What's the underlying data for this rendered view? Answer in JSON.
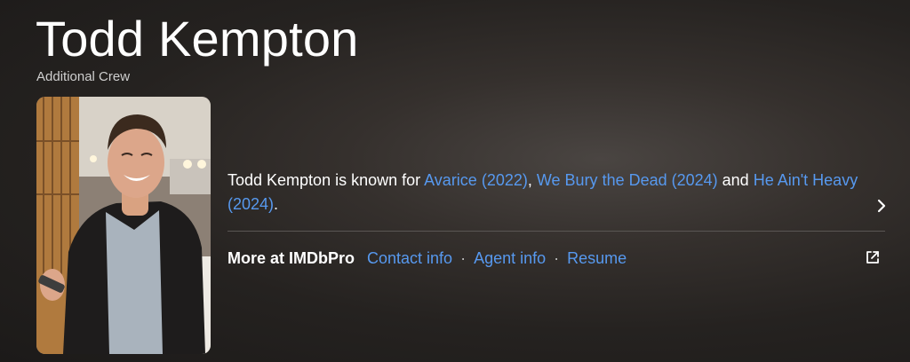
{
  "person": {
    "name": "Todd Kempton",
    "role": "Additional Crew"
  },
  "bio": {
    "intro": "Todd Kempton is known for ",
    "credits": [
      {
        "title": "Avarice (2022)"
      },
      {
        "title": "We Bury the Dead (2024)"
      },
      {
        "title": "He Ain't Heavy (2024)"
      }
    ],
    "sep_comma": ", ",
    "sep_and": " and ",
    "end": "."
  },
  "imdbpro": {
    "label": "More at IMDbPro",
    "links": [
      "Contact info",
      "Agent info",
      "Resume"
    ],
    "separator": "·"
  },
  "icons": {
    "expand": "chevron-right-icon",
    "external": "external-link-icon"
  },
  "colors": {
    "link": "#5799ef",
    "text": "#ffffff",
    "subtext": "#cfcfcf"
  }
}
